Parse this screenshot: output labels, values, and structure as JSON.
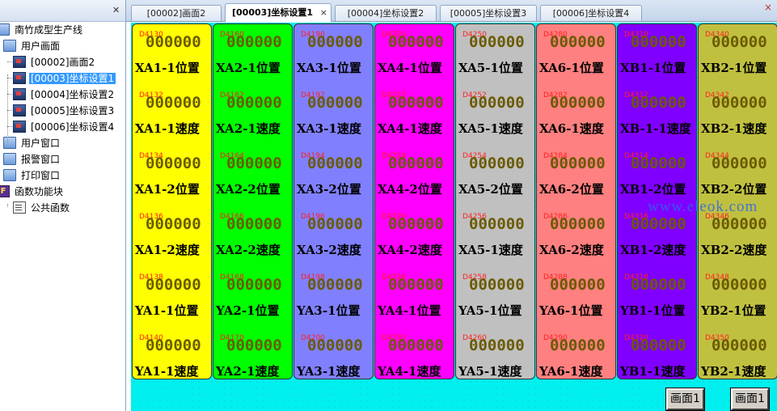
{
  "tree": {
    "header_buttons": {
      "pin": "࿭",
      "close": "✕"
    },
    "items": [
      {
        "label": "南竹成型生产线",
        "icon": "folder-icon",
        "level": 0
      },
      {
        "label": "用户画面",
        "icon": "folder-icon",
        "level": 1
      },
      {
        "label": "[00002]画面2",
        "icon": "screen-icon",
        "level": 2
      },
      {
        "label": "[00003]坐标设置1",
        "icon": "screen-icon",
        "level": 2,
        "selected": true
      },
      {
        "label": "[00004]坐标设置2",
        "icon": "screen-icon",
        "level": 2
      },
      {
        "label": "[00005]坐标设置3",
        "icon": "screen-icon",
        "level": 2
      },
      {
        "label": "[00006]坐标设置4",
        "icon": "screen-icon",
        "level": 2
      },
      {
        "label": "用户窗口",
        "icon": "folder-icon",
        "level": 1
      },
      {
        "label": "报警窗口",
        "icon": "folder-icon",
        "level": 1
      },
      {
        "label": "打印窗口",
        "icon": "folder-icon",
        "level": 1
      },
      {
        "label": "函数功能块",
        "icon": "function-icon",
        "level": 0
      },
      {
        "label": "公共函数",
        "icon": "document-icon",
        "level": 2
      }
    ]
  },
  "tabs": [
    {
      "label": "[00002]画面2"
    },
    {
      "label": "[00003]坐标设置1",
      "active": true,
      "close": "×"
    },
    {
      "label": "[00004]坐标设置2"
    },
    {
      "label": "[00005]坐标设置3"
    },
    {
      "label": "[00006]坐标设置4"
    }
  ],
  "tab_close_all": "×",
  "value_placeholder": "000000",
  "columns": [
    {
      "color": "#ffff00",
      "cells": [
        {
          "addr": "D4130",
          "label": "XA1-1位置"
        },
        {
          "addr": "D4132",
          "label": "XA1-1速度"
        },
        {
          "addr": "D4134",
          "label": "XA1-2位置"
        },
        {
          "addr": "D4136",
          "label": "XA1-2速度"
        },
        {
          "addr": "D4138",
          "label": "YA1-1位置"
        },
        {
          "addr": "D4140",
          "label": "YA1-1速度"
        }
      ]
    },
    {
      "color": "#00ff00",
      "cells": [
        {
          "addr": "D4160",
          "label": "XA2-1位置"
        },
        {
          "addr": "D4162",
          "label": "XA2-1速度"
        },
        {
          "addr": "D4164",
          "label": "XA2-2位置"
        },
        {
          "addr": "D4166",
          "label": "XA2-2速度"
        },
        {
          "addr": "D4168",
          "label": "YA2-1位置"
        },
        {
          "addr": "D4170",
          "label": "YA2-1速度"
        }
      ]
    },
    {
      "color": "#8080ff",
      "cells": [
        {
          "addr": "D4190",
          "label": "XA3-1位置"
        },
        {
          "addr": "D4192",
          "label": "XA3-1速度"
        },
        {
          "addr": "D4194",
          "label": "XA3-2位置"
        },
        {
          "addr": "D4196",
          "label": "XA3-2速度"
        },
        {
          "addr": "D4198",
          "label": "YA3-1位置"
        },
        {
          "addr": "D4200",
          "label": "YA3-1速度"
        }
      ]
    },
    {
      "color": "#ff00ff",
      "cells": [
        {
          "addr": "D4220",
          "label": "XA4-1位置"
        },
        {
          "addr": "D4222",
          "label": "XA4-1速度"
        },
        {
          "addr": "D4224",
          "label": "XA4-2位置"
        },
        {
          "addr": "D4226",
          "label": "XA4-2速度"
        },
        {
          "addr": "D4228",
          "label": "YA4-1位置"
        },
        {
          "addr": "D4230",
          "label": "YA4-1速度"
        }
      ]
    },
    {
      "color": "#c0c0c0",
      "cells": [
        {
          "addr": "D4250",
          "label": "XA5-1位置"
        },
        {
          "addr": "D4252",
          "label": "XA5-1速度"
        },
        {
          "addr": "D4254",
          "label": "XA5-2位置"
        },
        {
          "addr": "D4256",
          "label": "XA5-1速度"
        },
        {
          "addr": "D4258",
          "label": "YA5-1位置"
        },
        {
          "addr": "D4260",
          "label": "YA5-1速度"
        }
      ]
    },
    {
      "color": "#ff8080",
      "cells": [
        {
          "addr": "D4280",
          "label": "XA6-1位置"
        },
        {
          "addr": "D4282",
          "label": "XA6-1速度"
        },
        {
          "addr": "D4284",
          "label": "XA6-2位置"
        },
        {
          "addr": "D4286",
          "label": "XA6-2速度"
        },
        {
          "addr": "D4288",
          "label": "YA6-1位置"
        },
        {
          "addr": "D4290",
          "label": "YA6-1速度"
        }
      ]
    },
    {
      "color": "#8000ff",
      "cells": [
        {
          "addr": "D4310",
          "label": "XB1-1位置"
        },
        {
          "addr": "D4312",
          "label": "XB-1-1速度"
        },
        {
          "addr": "D4314",
          "label": "XB1-2位置"
        },
        {
          "addr": "D4316",
          "label": "XB1-2速度"
        },
        {
          "addr": "D4318",
          "label": "YB1-1位置"
        },
        {
          "addr": "D4320",
          "label": "YB1-1速度"
        }
      ]
    },
    {
      "color": "#c0c040",
      "cells": [
        {
          "addr": "D4340",
          "label": "XB2-1位置"
        },
        {
          "addr": "D4342",
          "label": "XB2-1速度"
        },
        {
          "addr": "D4344",
          "label": "XB2-2位置"
        },
        {
          "addr": "D4346",
          "label": "XB2-2速度"
        },
        {
          "addr": "D4348",
          "label": "YB2-1位置"
        },
        {
          "addr": "D4350",
          "label": "YB2-1速度"
        }
      ]
    }
  ],
  "watermark": "www.eleok.com",
  "nav_buttons": [
    {
      "label": "画面1"
    },
    {
      "label": "画面1"
    }
  ]
}
